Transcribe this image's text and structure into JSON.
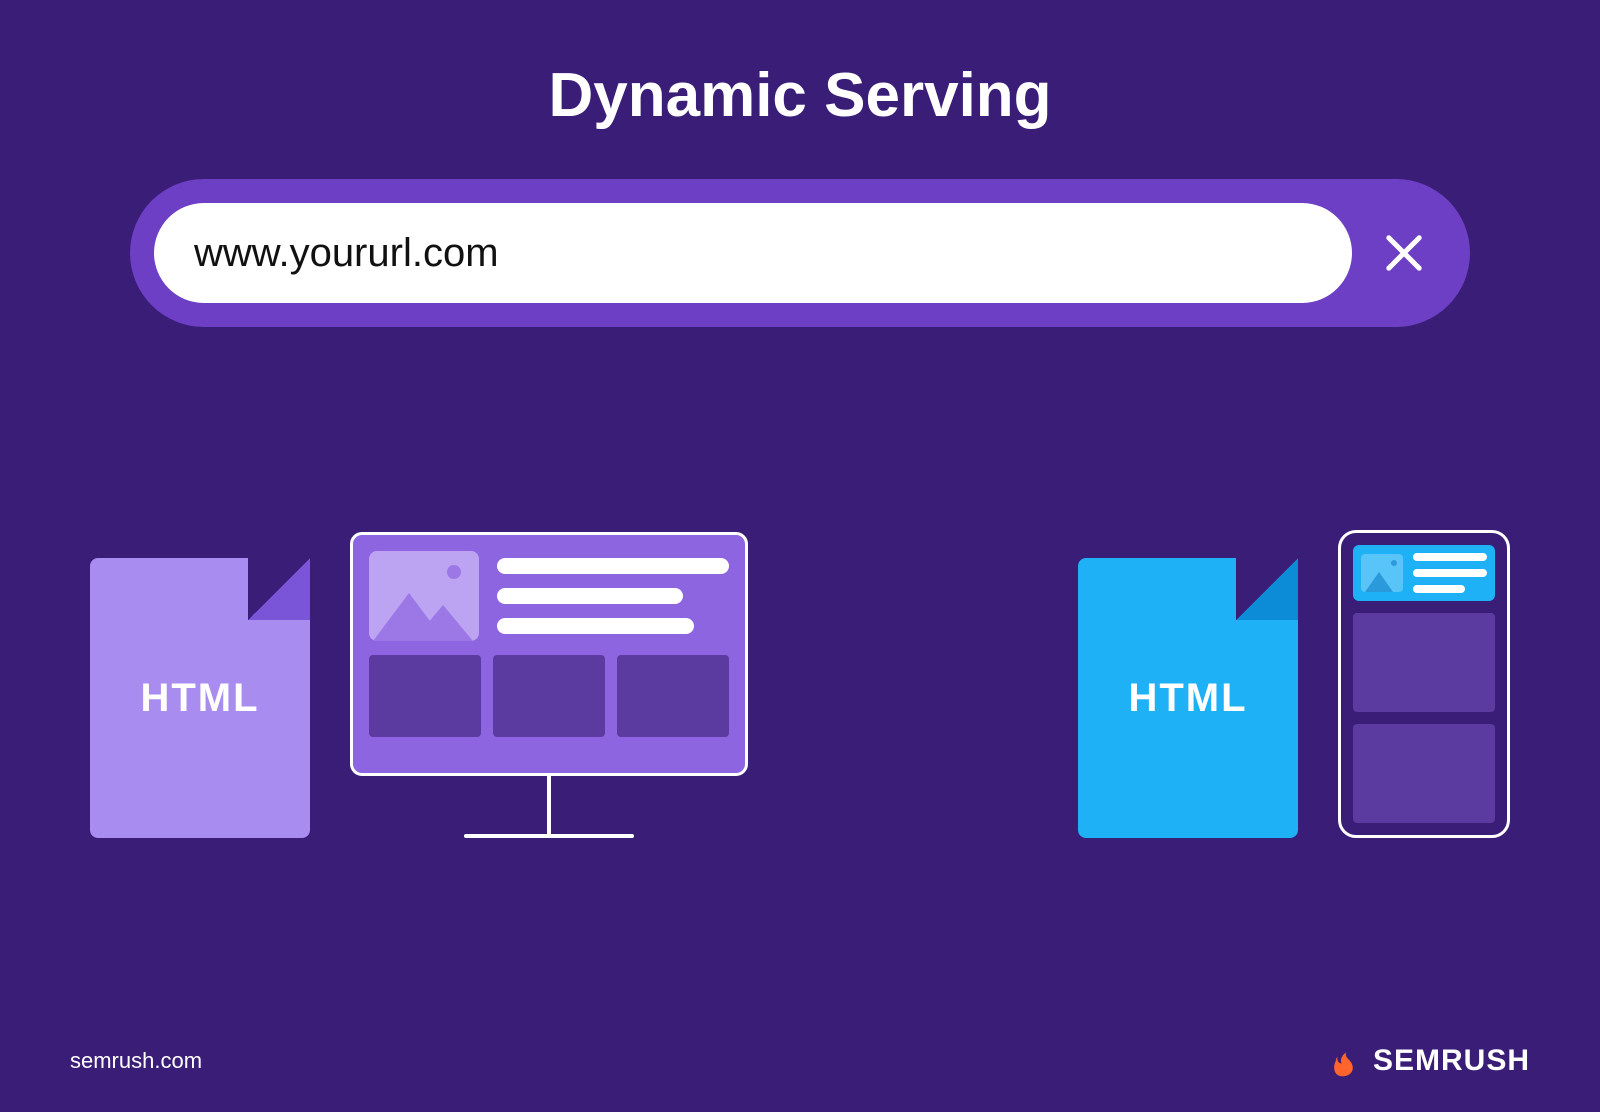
{
  "title": "Dynamic Serving",
  "search": {
    "url": "www.yoururl.com"
  },
  "desktop": {
    "file_label": "HTML"
  },
  "mobile": {
    "file_label": "HTML"
  },
  "footer": {
    "source": "semrush.com",
    "brand": "SEMRUSH"
  }
}
